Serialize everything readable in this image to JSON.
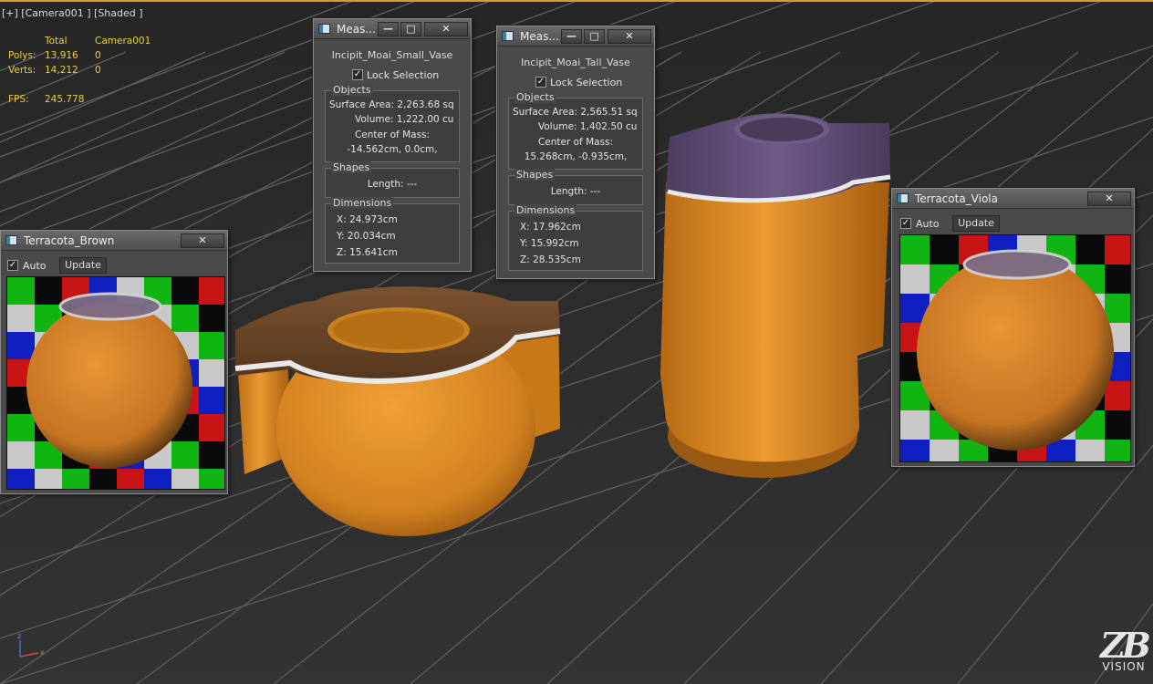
{
  "viewport": {
    "label": "[+] [Camera001 ] [Shaded ]",
    "stats": {
      "col_total": "Total",
      "col_camera": "Camera001",
      "polys_label": "Polys:",
      "polys_total": "13,916",
      "polys_camera": "0",
      "verts_label": "Verts:",
      "verts_total": "14,212",
      "verts_camera": "0",
      "fps_label": "FPS:",
      "fps_value": "245.778"
    },
    "logo": {
      "mark": "ZB",
      "text": "VISION"
    },
    "axis": {
      "z": "z",
      "x": "x"
    }
  },
  "measure_small": {
    "title": "Meas...",
    "object_name": "Incipit_Moai_Small_Vase",
    "lock_label": "Lock Selection",
    "lock_checked": true,
    "objects_label": "Objects",
    "surface_area": "Surface Area: 2,263.68 sq",
    "volume": "Volume: 1,222.00 cu",
    "com_label": "Center of Mass:",
    "com_value": "-14.562cm, 0.0cm,",
    "shapes_label": "Shapes",
    "length": "Length: ---",
    "dimensions_label": "Dimensions",
    "dim_x": "X:  24.973cm",
    "dim_y": "Y:  20.034cm",
    "dim_z": "Z:  15.641cm"
  },
  "measure_tall": {
    "title": "Meas...",
    "object_name": "Incipit_Moai_Tall_Vase",
    "lock_label": "Lock Selection",
    "lock_checked": true,
    "objects_label": "Objects",
    "surface_area": "Surface Area: 2,565.51 sq",
    "volume": "Volume: 1,402.50 cu",
    "com_label": "Center of Mass:",
    "com_value": "15.268cm, -0.935cm,",
    "shapes_label": "Shapes",
    "length": "Length: ---",
    "dimensions_label": "Dimensions",
    "dim_x": "X:  17.962cm",
    "dim_y": "Y:  15.992cm",
    "dim_z": "Z:  28.535cm"
  },
  "material_brown": {
    "title": "Terracota_Brown",
    "auto_label": "Auto",
    "auto_checked": true,
    "update_label": "Update",
    "sphere_color": "#c87822"
  },
  "material_viola": {
    "title": "Terracota_Viola",
    "auto_label": "Auto",
    "auto_checked": true,
    "update_label": "Update",
    "sphere_color": "#c87822"
  },
  "colors": {
    "stats_yellow": "#e8d040",
    "vase_orange": "#d98a23",
    "vase_brown_top": "#6b4528",
    "vase_purple_top": "#5e4c72",
    "check_red": "#c81414",
    "check_green": "#11b511",
    "check_blue": "#1020c0",
    "check_white": "#c8c8c8",
    "check_black": "#0a0a0a"
  },
  "icons": {
    "window": "app-window-icon",
    "minimize": "minimize-icon",
    "maximize": "maximize-icon",
    "close": "close-icon",
    "checkbox": "checkbox-checked-icon",
    "axis": "axis-gizmo-icon"
  }
}
